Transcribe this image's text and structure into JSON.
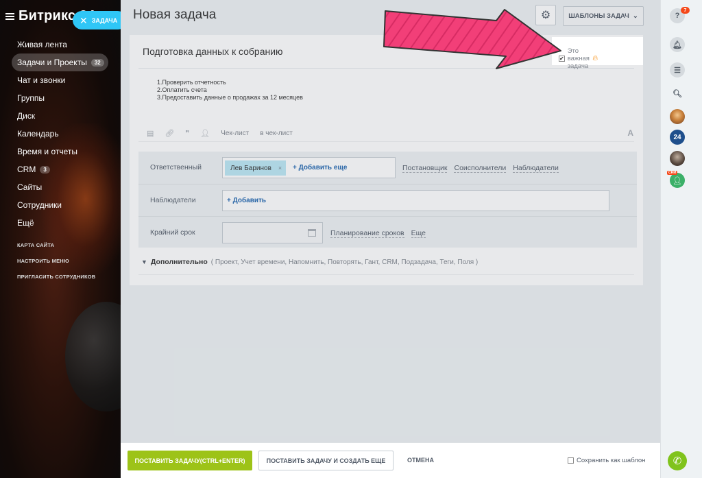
{
  "sidebar": {
    "brand": "Битрикс 24",
    "task_pill": "ЗАДАЧА",
    "items": [
      {
        "label": "Живая лента",
        "counter": ""
      },
      {
        "label": "Задачи и Проекты",
        "counter": "32"
      },
      {
        "label": "Чат и звонки",
        "counter": ""
      },
      {
        "label": "Группы",
        "counter": ""
      },
      {
        "label": "Диск",
        "counter": ""
      },
      {
        "label": "Календарь",
        "counter": ""
      },
      {
        "label": "Время и отчеты",
        "counter": ""
      },
      {
        "label": "CRM",
        "counter": "3"
      },
      {
        "label": "Сайты",
        "counter": ""
      },
      {
        "label": "Сотрудники",
        "counter": ""
      },
      {
        "label": "Ещё",
        "counter": ""
      }
    ],
    "sub_links": [
      "КАРТА САЙТА",
      "НАСТРОИТЬ МЕНЮ",
      "ПРИГЛАСИТЬ СОТРУДНИКОВ"
    ]
  },
  "header": {
    "title": "Новая задача",
    "templates_button": "ШАБЛОНЫ ЗАДАЧ"
  },
  "task": {
    "title": "Подготовка данных к собранию",
    "important_label": "Это важная задача",
    "important_checked": true,
    "description_lines": [
      "1.Проверить отчетность",
      "2.Оплатить счета",
      "3.Предоставить данные о продажах за 12 месяцев"
    ],
    "toolbar": {
      "checklist": "Чек-лист",
      "to_checklist": "в чек-лист",
      "text_format": "A"
    }
  },
  "fields": {
    "responsible": {
      "label": "Ответственный",
      "person": "Лев Баринов",
      "remove": "×",
      "add_more": "+ Добавить еще",
      "role_links": [
        "Постановщик",
        "Соисполнители",
        "Наблюдатели"
      ]
    },
    "observers": {
      "label": "Наблюдатели",
      "add": "+ Добавить"
    },
    "deadline": {
      "label": "Крайний срок",
      "value": "",
      "links": [
        "Планирование сроков",
        "Еще"
      ]
    }
  },
  "additional": {
    "label": "Дополнительно",
    "items": "( Проект,  Учет времени,  Напомнить,  Повторять,  Гант,  CRM,  Подзадача,  Теги,  Поля )"
  },
  "footer": {
    "primary": "ПОСТАВИТЬ ЗАДАЧУ(CTRL+ENTER)",
    "secondary": "ПОСТАВИТЬ ЗАДАЧУ И СОЗДАТЬ ЕЩЕ",
    "cancel": "ОТМЕНА",
    "save_template": "Сохранить как шаблон"
  },
  "right_panel": {
    "help_badge": "7",
    "avatar_24": "24",
    "crm_tag": "CRM"
  },
  "icons": [
    "menu-icon",
    "close-icon",
    "gear-icon",
    "chevron-down-icon",
    "flame-icon",
    "help-icon",
    "bell-icon",
    "chat-icon",
    "search-icon",
    "phone-icon",
    "calendar-icon"
  ],
  "colors": {
    "accent_blue": "#2fc6f6",
    "primary_green": "#9dc318",
    "chip_blue": "#bce8f5",
    "annotation_arrow": "#f23f78",
    "badge_red": "#f54819"
  }
}
